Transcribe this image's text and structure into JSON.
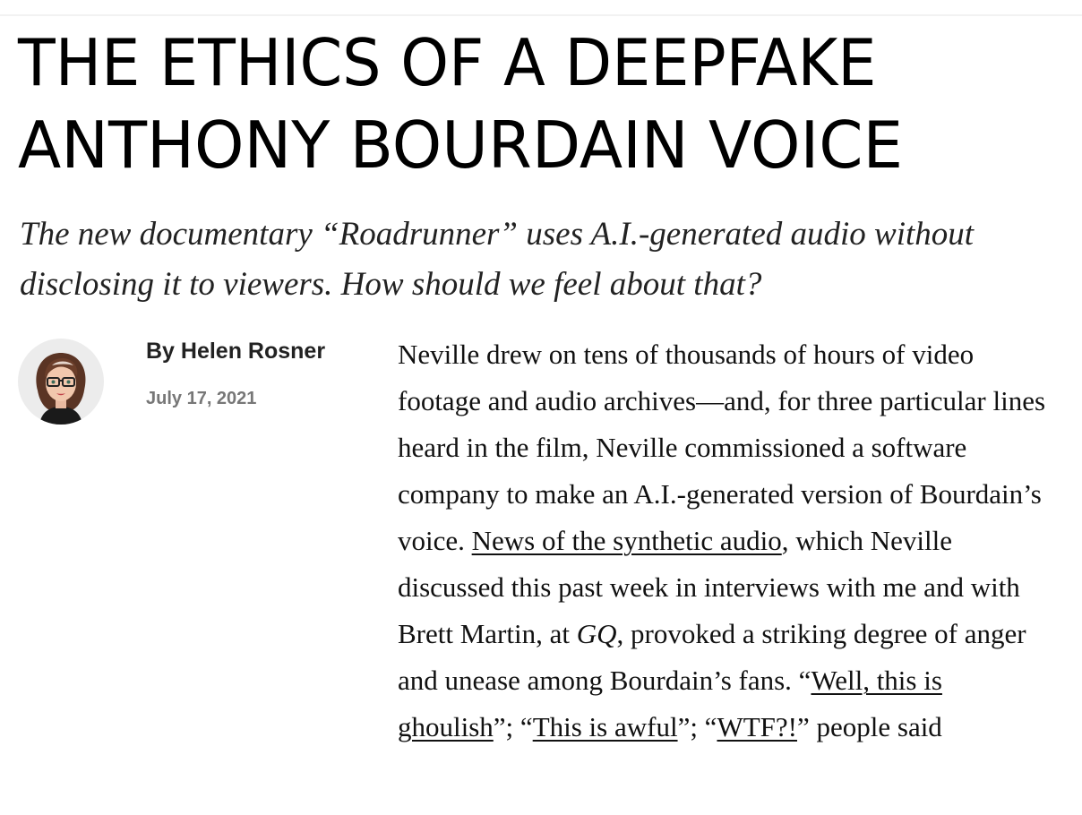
{
  "article": {
    "headline_line1": "THE ETHICS OF A DEEPFAKE",
    "headline_line2": "ANTHONY BOURDAIN VOICE",
    "dek": "The new documentary “Roadrunner” uses A.I.-generated audio without disclosing it to viewers. How should we feel about that?",
    "byline_prefix": "By ",
    "author": "Helen Rosner",
    "date": "July 17, 2021",
    "avatar_icon": "author-illustration-avatar",
    "body": {
      "seg1": "Neville drew on tens of thousands of hours of video footage and audio archives—and, for three particular lines heard in the film, Neville commissioned a software company to make an A.I.-generated version of Bourdain’s voice. ",
      "link1": "News of the synthetic audio",
      "seg2": ", which Neville discussed this past week in interviews with me and with Brett Martin, at ",
      "gq": "GQ",
      "seg3": ", provoked a striking degree of anger and unease among Bourdain’s fans. “",
      "link2": "Well, this is ghoulish",
      "seg4": "”; “",
      "link3": "This is awful",
      "seg5": "”; “",
      "link4": "WTF?!",
      "seg6": "” people said"
    }
  },
  "colors": {
    "text": "#111111",
    "meta": "#777777",
    "avatar_bg": "#ececec"
  }
}
